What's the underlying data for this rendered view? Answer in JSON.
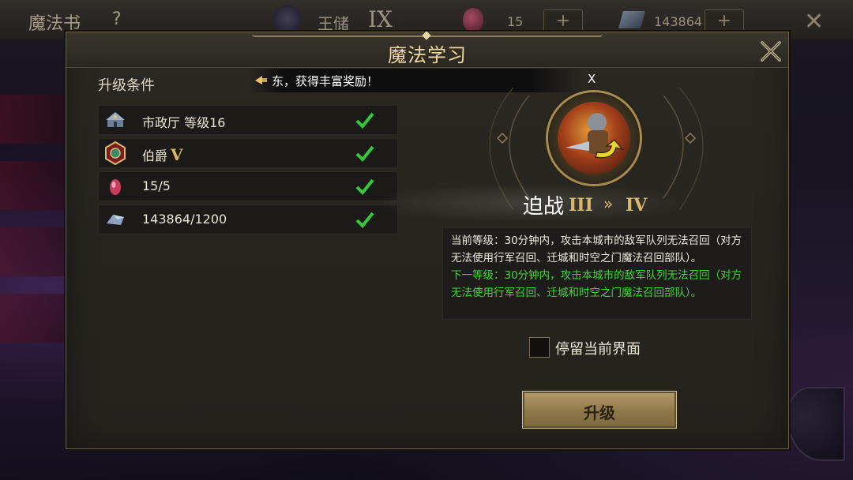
{
  "background": {
    "title": "魔法书",
    "help": "?",
    "rank_label": "王储",
    "rank_numeral": "IX",
    "gem_count": "15",
    "ore_count": "143864",
    "plus": "+",
    "close": "✕"
  },
  "dialog": {
    "title": "魔法学习",
    "conditions_header": "升级条件",
    "ticker": {
      "text": "东，获得丰富奖励！",
      "dismiss": "X"
    },
    "requirements": [
      {
        "icon": "city-hall-icon",
        "label": "市政厅 等级16",
        "roman": "",
        "met": true
      },
      {
        "icon": "noble-badge-icon",
        "label": "伯爵",
        "roman": "V",
        "met": true
      },
      {
        "icon": "red-gem-icon",
        "label": "15/5",
        "roman": "",
        "met": true
      },
      {
        "icon": "ore-icon",
        "label": "143864/1200",
        "roman": "",
        "met": true
      }
    ],
    "skill": {
      "name": "迫战",
      "current_level": "III",
      "arrow": "»",
      "next_level": "IV"
    },
    "description": {
      "current": "当前等级：30分钟内，攻击本城市的敌军队列无法召回（对方无法使用行军召回、迁城和时空之门魔法召回部队）。",
      "next": "下一等级：30分钟内，攻击本城市的敌军队列无法召回（对方无法使用行军召回、迁城和时空之门魔法召回部队）。"
    },
    "stay_checkbox": {
      "label": "停留当前界面",
      "checked": false
    },
    "upgrade_button": "升级"
  },
  "colors": {
    "title_gold": "#f0d9a0",
    "roman_gold": "#d8b86a",
    "check_green": "#34c93a",
    "next_level_green": "#43d43a",
    "button_gold": "#b59d6a"
  }
}
